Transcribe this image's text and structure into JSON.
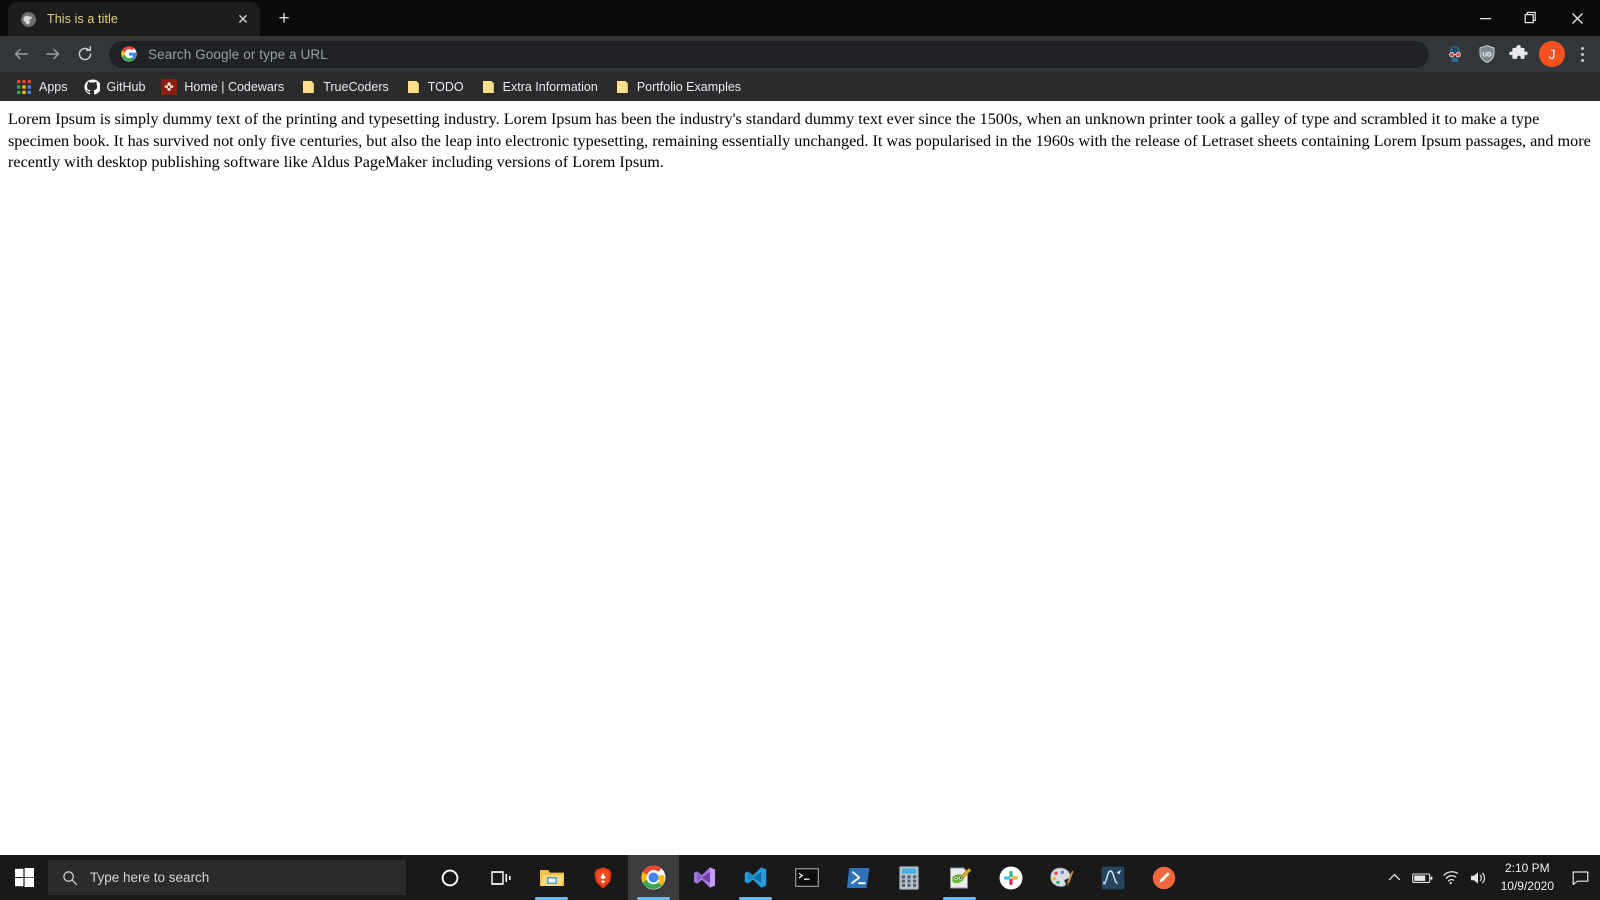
{
  "browser": {
    "tab": {
      "title": "This is a title",
      "favicon_name": "globe-favicon",
      "close_label": "✕"
    },
    "newtab_label": "+",
    "window_controls": {
      "minimize_name": "minimize-button",
      "restore_name": "restore-button",
      "close_name": "close-window-button"
    },
    "nav": {
      "back_name": "back-button",
      "forward_name": "forward-button",
      "reload_name": "reload-button"
    },
    "omnibox": {
      "placeholder": "Search Google or type a URL",
      "value": "",
      "leading_icon": "google-g-icon"
    },
    "extensions": [
      {
        "name": "hacker-glasses-extension-icon"
      },
      {
        "name": "ublock-shield-extension-icon",
        "label": "UD"
      },
      {
        "name": "extensions-puzzle-icon"
      }
    ],
    "profile": {
      "initial": "J",
      "color": "#f4511e"
    },
    "menu_name": "chrome-menu-button",
    "bookmarks": [
      {
        "label": "Apps",
        "icon": "apps-grid-icon"
      },
      {
        "label": "GitHub",
        "icon": "github-icon"
      },
      {
        "label": "Home | Codewars",
        "icon": "codewars-icon"
      },
      {
        "label": "TrueCoders",
        "icon": "folder-icon"
      },
      {
        "label": "TODO",
        "icon": "folder-icon"
      },
      {
        "label": "Extra Information",
        "icon": "folder-icon"
      },
      {
        "label": "Portfolio Examples",
        "icon": "folder-icon"
      }
    ]
  },
  "page": {
    "body_text": "Lorem Ipsum is simply dummy text of the printing and typesetting industry. Lorem Ipsum has been the industry's standard dummy text ever since the 1500s, when an unknown printer took a galley of type and scrambled it to make a type specimen book. It has survived not only five centuries, but also the leap into electronic typesetting, remaining essentially unchanged. It was popularised in the 1960s with the release of Letraset sheets containing Lorem Ipsum passages, and more recently with desktop publishing software like Aldus PageMaker including versions of Lorem Ipsum."
  },
  "taskbar": {
    "start_name": "start-button",
    "search": {
      "placeholder": "Type here to search",
      "value": "",
      "icon": "search-icon"
    },
    "items": [
      {
        "name": "cortana-button",
        "icon": "cortana-circle-icon",
        "active": false,
        "running": false
      },
      {
        "name": "task-view-button",
        "icon": "task-view-icon",
        "active": false,
        "running": false
      },
      {
        "name": "file-explorer-button",
        "icon": "file-explorer-icon",
        "active": false,
        "running": true
      },
      {
        "name": "brave-button",
        "icon": "brave-lion-icon",
        "active": false,
        "running": false
      },
      {
        "name": "chrome-button",
        "icon": "chrome-icon",
        "active": true,
        "running": true
      },
      {
        "name": "visual-studio-button",
        "icon": "visual-studio-icon",
        "active": false,
        "running": false
      },
      {
        "name": "vs-code-button",
        "icon": "vs-code-icon",
        "active": false,
        "running": true
      },
      {
        "name": "terminal-button",
        "icon": "terminal-icon",
        "active": false,
        "running": false
      },
      {
        "name": "powershell-button",
        "icon": "powershell-icon",
        "active": false,
        "running": false
      },
      {
        "name": "calculator-button",
        "icon": "calculator-icon",
        "active": false,
        "running": false
      },
      {
        "name": "notepad-plus-plus-button",
        "icon": "notepad-plus-plus-icon",
        "active": false,
        "running": true
      },
      {
        "name": "slack-button",
        "icon": "slack-icon",
        "active": false,
        "running": false
      },
      {
        "name": "paint-button",
        "icon": "paint-palette-icon",
        "active": false,
        "running": false
      },
      {
        "name": "curve-tool-button",
        "icon": "curve-editor-icon",
        "active": false,
        "running": false
      },
      {
        "name": "postman-button",
        "icon": "postman-icon",
        "active": false,
        "running": false
      }
    ],
    "tray": {
      "show_hidden_icons": "∧",
      "battery_name": "battery-icon",
      "network_name": "wifi-icon",
      "volume_name": "volume-icon",
      "time": "2:10 PM",
      "date": "10/9/2020",
      "action_center_name": "action-center-icon"
    }
  }
}
